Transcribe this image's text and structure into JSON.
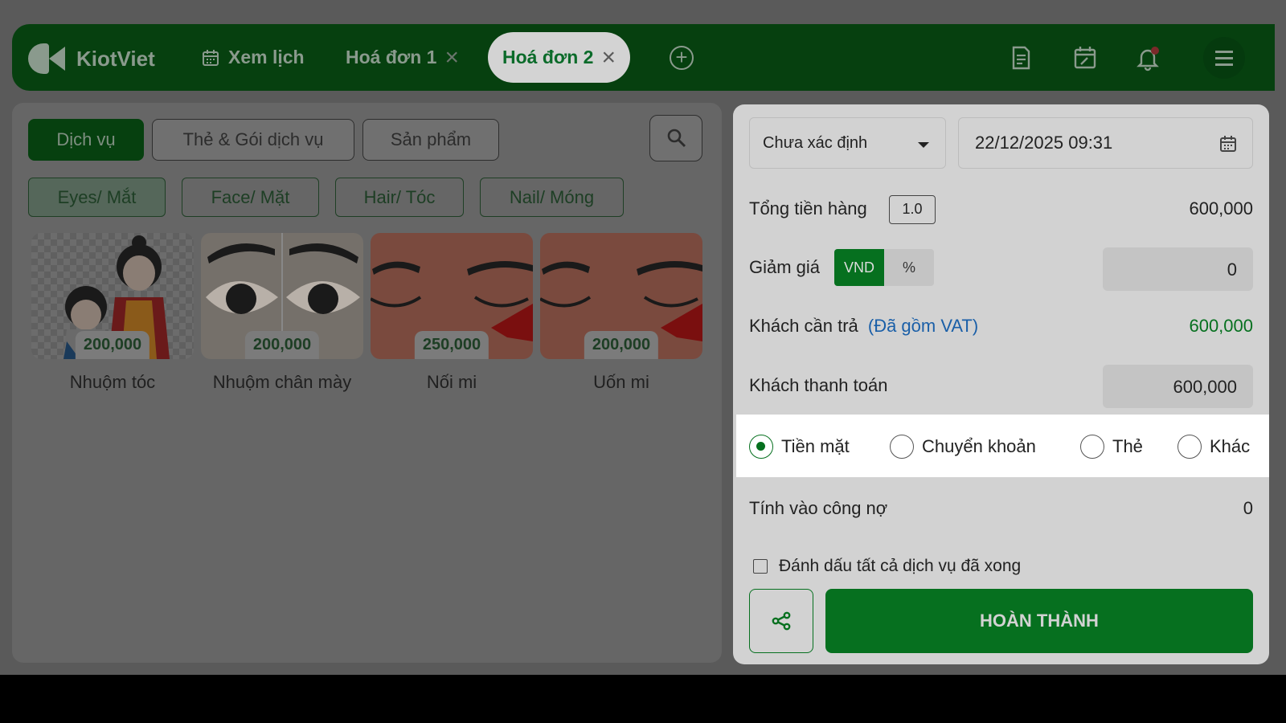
{
  "header": {
    "brand": "KiotViet",
    "tabs": [
      {
        "label": "Xem lịch"
      },
      {
        "label": "Hoá đơn 1"
      },
      {
        "label": "Hoá đơn 2"
      }
    ]
  },
  "left": {
    "categories": [
      "Dịch vụ",
      "Thẻ & Gói dịch vụ",
      "Sản phẩm"
    ],
    "subcategories": [
      "Eyes/ Mắt",
      "Face/ Mặt",
      "Hair/ Tóc",
      "Nail/ Móng"
    ],
    "services": [
      {
        "name": "Nhuộm tóc",
        "price": "200,000"
      },
      {
        "name": "Nhuộm chân mày",
        "price": "200,000"
      },
      {
        "name": "Nối mi",
        "price": "250,000"
      },
      {
        "name": "Uốn mi",
        "price": "200,000"
      }
    ]
  },
  "payment": {
    "customer_select": "Chưa xác định",
    "datetime": "22/12/2025 09:31",
    "total_label": "Tổng tiền hàng",
    "total_badge": "1.0",
    "total_value": "600,000",
    "discount_label": "Giảm giá",
    "discount_unit_vnd": "VND",
    "discount_unit_pct": "%",
    "discount_value": "0",
    "due_label": "Khách cần trả",
    "due_note": "(Đã gồm VAT)",
    "due_value": "600,000",
    "paid_label": "Khách thanh toán",
    "paid_value": "600,000",
    "methods": [
      "Tiền mặt",
      "Chuyển khoản",
      "Thẻ",
      "Khác"
    ],
    "debt_label": "Tính vào công nợ",
    "debt_value": "0",
    "mark_done_label": "Đánh dấu tất cả dịch vụ đã xong",
    "complete_label": "HOÀN THÀNH"
  },
  "colors": {
    "brand_green": "#06701f",
    "header_green": "#06400f",
    "link_blue": "#1a5fa8"
  },
  "icons": {
    "header": [
      "calendar-icon",
      "close-icon",
      "add-tab-icon",
      "receipt-icon",
      "calendar-edit-icon",
      "bell-icon",
      "menu-icon"
    ],
    "panel": [
      "search-icon",
      "calendar-icon",
      "caret-down-icon",
      "share-icon"
    ]
  }
}
